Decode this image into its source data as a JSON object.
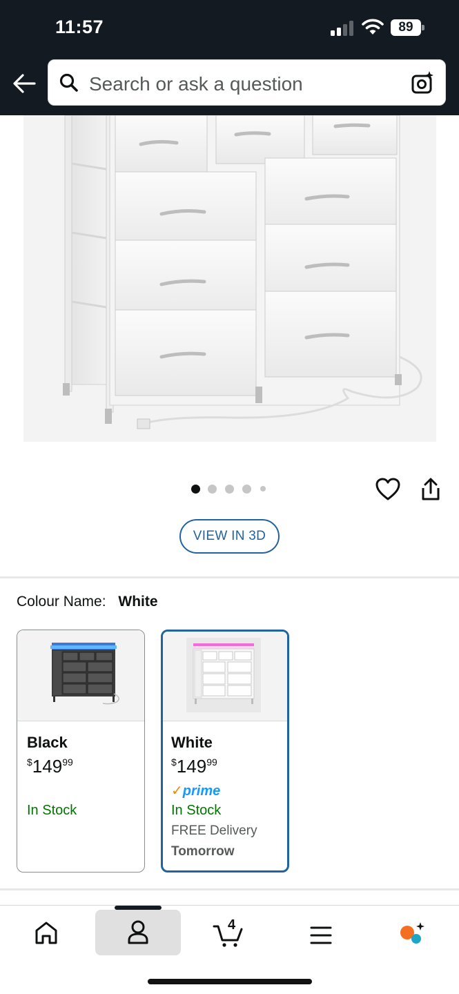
{
  "status_bar": {
    "time": "11:57",
    "battery": "89"
  },
  "header": {
    "search_placeholder": "Search or ask a question"
  },
  "gallery": {
    "dot_count": 5,
    "active_dot": 0,
    "view_3d_label": "VIEW IN 3D"
  },
  "colour": {
    "label": "Colour Name:",
    "selected_value": "White",
    "options": [
      {
        "name": "Black",
        "price_whole": "149",
        "price_fraction": "99",
        "currency": "$",
        "stock": "In Stock",
        "prime": false
      },
      {
        "name": "White",
        "price_whole": "149",
        "price_fraction": "99",
        "currency": "$",
        "prime_label": "prime",
        "stock": "In Stock",
        "delivery": "FREE Delivery",
        "delivery_day": "Tomorrow",
        "prime": true,
        "selected": true
      }
    ]
  },
  "bottom_nav": {
    "cart_count": "4",
    "items": [
      "home-icon",
      "account-icon",
      "cart-icon",
      "menu-icon",
      "rufus-icon"
    ],
    "active": "account-icon"
  },
  "colors": {
    "header_bg": "#131a22",
    "accent_blue": "#2162a1",
    "stock_green": "#007600",
    "prime_blue": "#1399ff",
    "prime_orange": "#f08804"
  }
}
